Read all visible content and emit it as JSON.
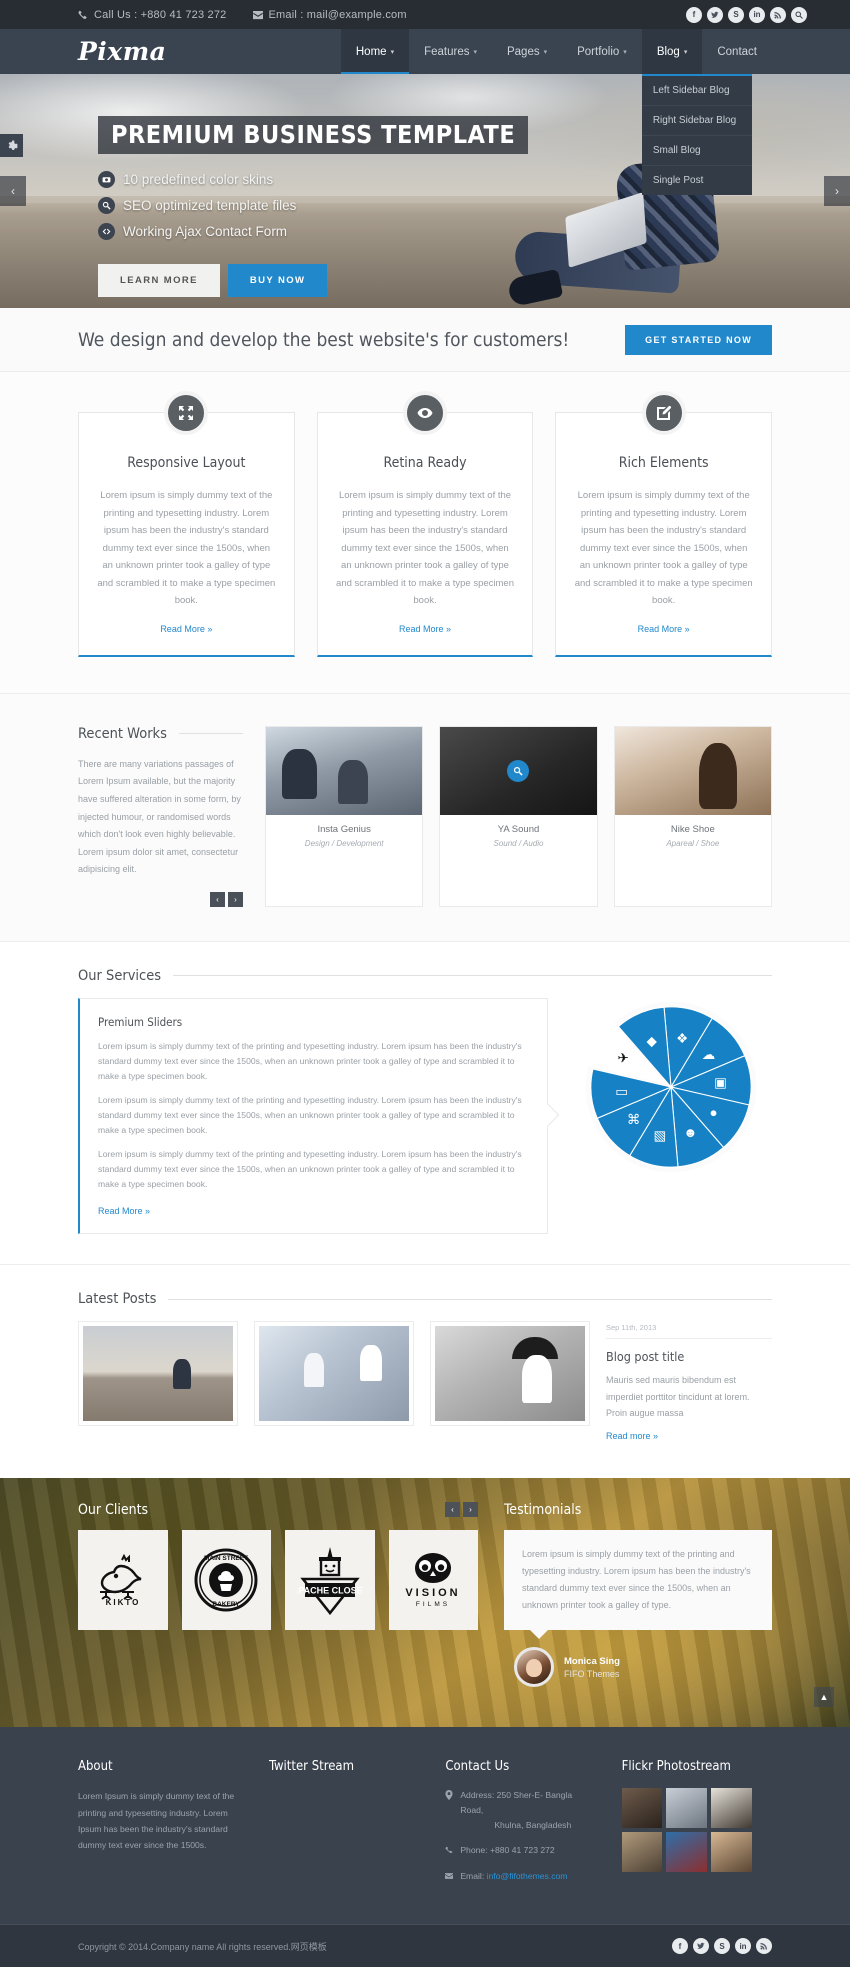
{
  "topbar": {
    "phone_label": "Call Us : +880 41 723 272",
    "email_label": "Email : mail@example.com",
    "socials": [
      "facebook-icon",
      "twitter-icon",
      "skype-icon",
      "linkedin-icon",
      "rss-icon",
      "search-icon"
    ]
  },
  "nav": {
    "logo": "Pixma",
    "items": [
      {
        "label": "Home",
        "caret": "▾",
        "state": "active"
      },
      {
        "label": "Features",
        "caret": "▾",
        "state": ""
      },
      {
        "label": "Pages",
        "caret": "▾",
        "state": ""
      },
      {
        "label": "Portfolio",
        "caret": "▾",
        "state": ""
      },
      {
        "label": "Blog",
        "caret": "▾",
        "state": "open"
      },
      {
        "label": "Contact",
        "caret": "",
        "state": ""
      }
    ],
    "dropdown": [
      "Left Sidebar Blog",
      "Right Sidebar Blog",
      "Small Blog",
      "Single Post"
    ]
  },
  "hero": {
    "title": "PREMIUM BUSINESS TEMPLATE",
    "bullets": [
      {
        "text": "10 predefined color skins",
        "icon": "camera-icon"
      },
      {
        "text": "SEO optimized template files",
        "icon": "search-icon"
      },
      {
        "text": "Working Ajax Contact Form",
        "icon": "code-icon"
      }
    ],
    "btn_learn": "LEARN MORE",
    "btn_buy": "BUY NOW",
    "arrow_prev": "‹",
    "arrow_next": "›"
  },
  "tagline": {
    "heading": "We design and develop the best website's for customers!",
    "button": "GET STARTED NOW"
  },
  "features": [
    {
      "icon": "expand-arrows-icon",
      "title": "Responsive Layout",
      "body": "Lorem ipsum is simply dummy text of the printing and typesetting industry. Lorem ipsum has been the industry's standard dummy text ever since the 1500s, when an unknown printer took a galley of type and scrambled it to make a type specimen book.",
      "link": "Read More »"
    },
    {
      "icon": "eye-icon",
      "title": "Retina Ready",
      "body": "Lorem ipsum is simply dummy text of the printing and typesetting industry. Lorem ipsum has been the industry's standard dummy text ever since the 1500s, when an unknown printer took a galley of type and scrambled it to make a type specimen book.",
      "link": "Read More »"
    },
    {
      "icon": "pencil-square-icon",
      "title": "Rich Elements",
      "body": "Lorem ipsum is simply dummy text of the printing and typesetting industry. Lorem ipsum has been the industry's standard dummy text ever since the 1500s, when an unknown printer took a galley of type and scrambled it to make a type specimen book.",
      "link": "Read More »"
    }
  ],
  "recent_works": {
    "heading": "Recent Works",
    "intro": "There are many variations passages of Lorem Ipsum available, but the majority have suffered alteration in some form, by injected humour, or randomised words which don't look even highly believable. Lorem ipsum dolor sit amet, consectetur adipisicing elit.",
    "prev": "‹",
    "next": "›",
    "items": [
      {
        "title": "Insta Genius",
        "subtitle": "Design / Development"
      },
      {
        "title": "YA Sound",
        "subtitle": "Sound / Audio"
      },
      {
        "title": "Nike Shoe",
        "subtitle": "Apareal / Shoe"
      }
    ]
  },
  "services": {
    "heading": "Our Services",
    "box_title": "Premium Sliders",
    "paragraphs": [
      "Lorem ipsum is simply dummy text of the printing and typesetting industry. Lorem ipsum has been the industry's standard dummy text ever since the 1500s, when an unknown printer took a galley of type and scrambled it to make a type specimen book.",
      "Lorem ipsum is simply dummy text of the printing and typesetting industry. Lorem ipsum has been the industry's standard dummy text ever since the 1500s, when an unknown printer took a galley of type and scrambled it to make a type specimen book.",
      "Lorem ipsum is simply dummy text of the printing and typesetting industry. Lorem ipsum has been the industry's standard dummy text ever since the 1500s, when an unknown printer took a galley of type and scrambled it to make a type specimen book."
    ],
    "link": "Read More »",
    "wheel": {
      "segments": 10,
      "active_index": 8,
      "fill": "#1681c4",
      "active_fill": "#ffffff",
      "icons": [
        "puzzle-icon",
        "cloud-icon",
        "photo-frame-icon",
        "droplets-icon",
        "person-icon",
        "image-icon",
        "mouse-icon",
        "card-icon",
        "rocket-icon"
      ]
    }
  },
  "latest_posts": {
    "heading": "Latest Posts",
    "date": "Sep 11th, 2013",
    "title": "Blog post title",
    "excerpt": "Mauris sed mauris bibendum est imperdiet porttitor tincidunt at lorem. Proin augue massa",
    "link": "Read more »"
  },
  "clients": {
    "heading": "Our Clients",
    "prev": "‹",
    "next": "›",
    "logos": [
      {
        "name": "KIKTO",
        "mark": "bird-logo-icon"
      },
      {
        "name": "MAIN STREET BAKERY",
        "mark": "cupcake-badge-icon"
      },
      {
        "name": "APACHE CLOSET",
        "mark": "apache-closet-icon"
      },
      {
        "name": "VISION FILMS",
        "mark": "owl-logo-icon"
      }
    ]
  },
  "testimonials": {
    "heading": "Testimonials",
    "quote": "Lorem ipsum is simply dummy text of the printing and typesetting industry. Lorem ipsum has been the industry's standard dummy text ever since the 1500s, when an unknown printer took a galley of type.",
    "author_name": "Monica Sing",
    "author_company": "FIFO Themes"
  },
  "footer": {
    "about": {
      "heading": "About",
      "body": "Lorem Ipsum is simply dummy text of the printing and typesetting industry. Lorem Ipsum has been the industry's standard dummy text ever since the 1500s."
    },
    "twitter": {
      "heading": "Twitter Stream"
    },
    "contact": {
      "heading": "Contact Us",
      "address_label": "Address: 250 Sher-E- Bangla Road,",
      "address_label2": "Khulna, Bangladesh",
      "phone_label": "Phone: +880 41 723 272",
      "email_label": "Email:",
      "email_value": "info@fifothemes.com"
    },
    "flickr": {
      "heading": "Flickr Photostream"
    }
  },
  "copyright": {
    "text": "Copyright © 2014.Company name All rights reserved.网页模板",
    "socials": [
      "facebook-icon",
      "twitter-icon",
      "skype-icon",
      "linkedin-icon",
      "rss-icon"
    ]
  },
  "scroll_top": "▲",
  "colors": {
    "accent": "#2288cc",
    "nav_bg": "#3a4450",
    "topbar_bg": "#282d33",
    "footer_bg": "#3a424e"
  }
}
